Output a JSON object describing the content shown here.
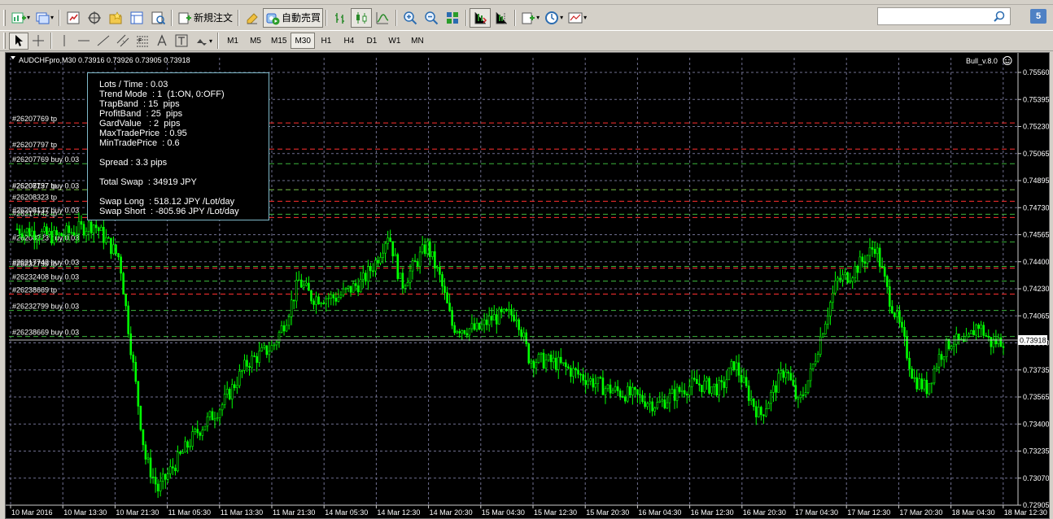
{
  "toolbar": {
    "new_order_label": "新規注文",
    "auto_trade_label": "自動売買",
    "search_placeholder": "",
    "notification_count": "5",
    "timeframes": [
      "M1",
      "M5",
      "M15",
      "M30",
      "H1",
      "H4",
      "D1",
      "W1",
      "MN"
    ],
    "active_timeframe": "M30",
    "icons": [
      "new-chart-icon",
      "profiles-icon",
      "market-watch-icon",
      "data-window-icon",
      "navigator-icon",
      "terminal-icon",
      "strategy-tester-icon",
      "new-order-icon",
      "metaeditor-icon",
      "auto-trading-icon",
      "bar-chart-icon",
      "candlestick-icon",
      "line-chart-icon",
      "zoom-in-icon",
      "zoom-out-icon",
      "tile-windows-icon",
      "autoscroll-icon",
      "chart-shift-icon",
      "indicators-icon",
      "periods-icon",
      "templates-icon",
      "cursor-icon",
      "crosshair-icon",
      "vertical-line-icon",
      "horizontal-line-icon",
      "trendline-icon",
      "equidistant-channel-icon",
      "fibonacci-icon",
      "text-icon",
      "text-label-icon",
      "arrows-icon"
    ]
  },
  "chart": {
    "header": "AUDCHFpro,M30  0.73916 0.73926 0.73905 0.73918",
    "ea_label": "Bull_v.8.0",
    "current_price_label": "0.73918",
    "colors": {
      "background": "#000000",
      "candle": "#00ff00",
      "grid": "#6f6f8f",
      "tp_line": "#ff3030",
      "buy_line": "#3cb43c",
      "price_line": "#c0c0c0"
    }
  },
  "infobox": {
    "lots": "Lots / Time : 0.03",
    "trend_mode": "Trend Mode  : 1  (1:ON, 0:OFF)",
    "trap_band": "TrapBand  : 15  pips",
    "profit_band": "ProfitBand  : 25  pips",
    "gard_value": "GardValue   : 2  pips",
    "max_trade_price": "MaxTradePrice  : 0.95",
    "min_trade_price": "MinTradePrice  : 0.6",
    "spread": "Spread : 3.3 pips",
    "total_swap": "Total Swap  : 34919 JPY",
    "swap_long": "Swap Long  : 518.12 JPY /Lot/day",
    "swap_short": "Swap Short  : -805.96 JPY /Lot/day"
  },
  "chart_data": {
    "type": "candlestick",
    "symbol": "AUDCHFpro",
    "timeframe": "M30",
    "ohlc_last": {
      "open": 0.73916,
      "high": 0.73926,
      "low": 0.73905,
      "close": 0.73918
    },
    "y_tick_labels": [
      "0.75560",
      "0.75395",
      "0.75230",
      "0.75065",
      "0.74895",
      "0.74730",
      "0.74565",
      "0.74400",
      "0.74230",
      "0.74065",
      "0.73900",
      "0.73735",
      "0.73565",
      "0.73400",
      "0.73235",
      "0.73070",
      "0.72905"
    ],
    "ylim": [
      0.72905,
      0.7565
    ],
    "x_tick_labels": [
      "10 Mar 2016",
      "10 Mar 13:30",
      "10 Mar 21:30",
      "11 Mar 05:30",
      "11 Mar 13:30",
      "11 Mar 21:30",
      "14 Mar 05:30",
      "14 Mar 12:30",
      "14 Mar 20:30",
      "15 Mar 04:30",
      "15 Mar 12:30",
      "15 Mar 20:30",
      "16 Mar 04:30",
      "16 Mar 12:30",
      "16 Mar 20:30",
      "17 Mar 04:30",
      "17 Mar 12:30",
      "17 Mar 20:30",
      "18 Mar 04:30",
      "18 Mar 12:30"
    ],
    "grid": true,
    "price_path": [
      {
        "x": 0,
        "y": 0.746
      },
      {
        "x": 3,
        "y": 0.7455
      },
      {
        "x": 6,
        "y": 0.7463
      },
      {
        "x": 8,
        "y": 0.7442
      },
      {
        "x": 9,
        "y": 0.738
      },
      {
        "x": 10,
        "y": 0.732
      },
      {
        "x": 11,
        "y": 0.73
      },
      {
        "x": 12,
        "y": 0.7312
      },
      {
        "x": 14,
        "y": 0.7335
      },
      {
        "x": 16,
        "y": 0.7352
      },
      {
        "x": 18,
        "y": 0.7378
      },
      {
        "x": 20,
        "y": 0.7388
      },
      {
        "x": 21,
        "y": 0.7405
      },
      {
        "x": 22,
        "y": 0.7428
      },
      {
        "x": 23,
        "y": 0.7418
      },
      {
        "x": 25,
        "y": 0.7418
      },
      {
        "x": 27,
        "y": 0.7428
      },
      {
        "x": 28,
        "y": 0.744
      },
      {
        "x": 29,
        "y": 0.7458
      },
      {
        "x": 30,
        "y": 0.7425
      },
      {
        "x": 32,
        "y": 0.745
      },
      {
        "x": 33,
        "y": 0.743
      },
      {
        "x": 34,
        "y": 0.74
      },
      {
        "x": 36,
        "y": 0.7398
      },
      {
        "x": 37,
        "y": 0.7405
      },
      {
        "x": 39,
        "y": 0.7408
      },
      {
        "x": 40,
        "y": 0.738
      },
      {
        "x": 42,
        "y": 0.7378
      },
      {
        "x": 44,
        "y": 0.737
      },
      {
        "x": 46,
        "y": 0.7362
      },
      {
        "x": 48,
        "y": 0.7358
      },
      {
        "x": 50,
        "y": 0.7352
      },
      {
        "x": 52,
        "y": 0.7362
      },
      {
        "x": 53,
        "y": 0.7365
      },
      {
        "x": 55,
        "y": 0.7362
      },
      {
        "x": 56,
        "y": 0.7378
      },
      {
        "x": 57,
        "y": 0.736
      },
      {
        "x": 58,
        "y": 0.7345
      },
      {
        "x": 60,
        "y": 0.7375
      },
      {
        "x": 61,
        "y": 0.7352
      },
      {
        "x": 62,
        "y": 0.7372
      },
      {
        "x": 63,
        "y": 0.7402
      },
      {
        "x": 64,
        "y": 0.7428
      },
      {
        "x": 65,
        "y": 0.7432
      },
      {
        "x": 66,
        "y": 0.744
      },
      {
        "x": 67,
        "y": 0.745
      },
      {
        "x": 68,
        "y": 0.742
      },
      {
        "x": 69,
        "y": 0.7398
      },
      {
        "x": 70,
        "y": 0.7368
      },
      {
        "x": 71,
        "y": 0.7362
      },
      {
        "x": 72,
        "y": 0.7382
      },
      {
        "x": 73,
        "y": 0.7392
      },
      {
        "x": 74,
        "y": 0.7388
      },
      {
        "x": 75,
        "y": 0.7402
      },
      {
        "x": 76,
        "y": 0.739
      },
      {
        "x": 77,
        "y": 0.7392
      }
    ],
    "tp_levels": [
      {
        "label": "#26207769 tp",
        "y": 0.7525
      },
      {
        "label": "#26207797 tp",
        "y": 0.7509
      },
      {
        "label": "#26208137 tp",
        "y": 0.7484
      },
      {
        "label": "#26208323 tp",
        "y": 0.7477
      },
      {
        "label": "#26217742 tp",
        "y": 0.7467
      },
      {
        "label": "#26232799 tp",
        "y": 0.7436
      },
      {
        "label": "#26238669 tp",
        "y": 0.742
      }
    ],
    "buy_levels": [
      {
        "label": "#26207769 buy 0.03",
        "y": 0.75
      },
      {
        "label": "#26207797 buy 0.03",
        "y": 0.7484
      },
      {
        "label": "#26208137 buy 0.03",
        "y": 0.7469
      },
      {
        "label": "#26208323 buy 0.03",
        "y": 0.7452
      },
      {
        "label": "#26217742 buy 0.03",
        "y": 0.7437
      },
      {
        "label": "#26232408 buy 0.03",
        "y": 0.7428
      },
      {
        "label": "#26232799 buy 0.03",
        "y": 0.741
      },
      {
        "label": "#26238669 buy 0.03",
        "y": 0.7394
      }
    ]
  }
}
